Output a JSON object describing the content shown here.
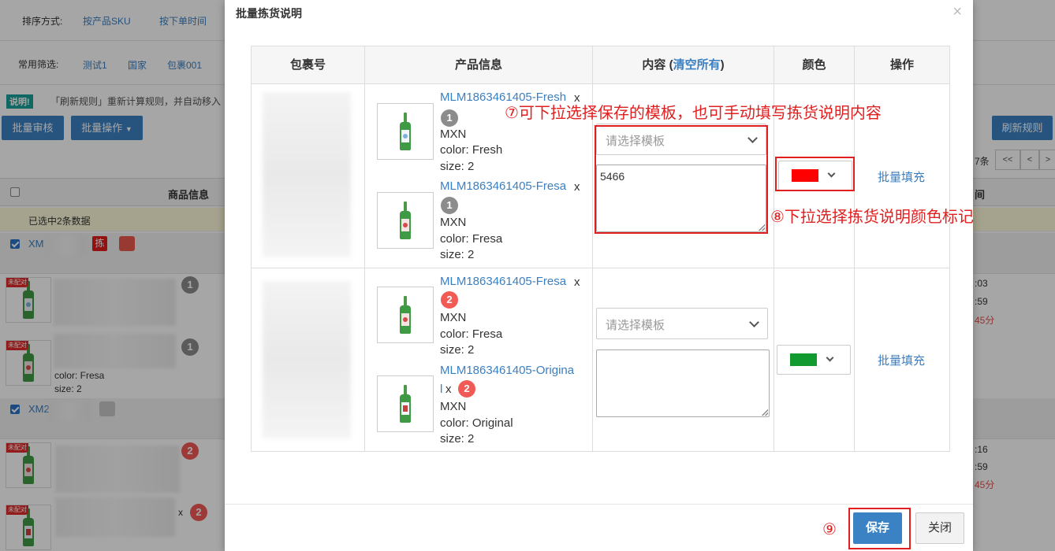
{
  "background": {
    "sort": {
      "label": "排序方式:",
      "options": [
        "按产品SKU",
        "按下单时间"
      ]
    },
    "filters": {
      "label": "常用筛选:",
      "items": [
        "测试1",
        "国家",
        "包裹001"
      ]
    },
    "note": {
      "badge": "说明!",
      "text": "「刷新规则」重新计算规则，并自动移入"
    },
    "buttons": {
      "batch_review": "批量审核",
      "batch_ops": "批量操作",
      "refresh_rules": "刷新规则"
    },
    "pager": {
      "count_suffix": "7条",
      "first": "<<",
      "prev": "<",
      "next": ">"
    },
    "table": {
      "col_product": "商品信息",
      "col_time": "间",
      "selected_text": "已选中2条数据"
    },
    "orders": [
      {
        "id": "XM",
        "tag": "拣",
        "items": [
          {
            "badge": "未配对",
            "qty": "1"
          },
          {
            "badge": "未配对",
            "qty": "1",
            "color": "color: Fresa",
            "size": "size: 2"
          }
        ],
        "times": [
          ":03",
          ":59"
        ],
        "remain": "45分"
      },
      {
        "id": "XM2",
        "items": [
          {
            "badge": "未配对",
            "qty": "2"
          },
          {
            "badge": "未配对",
            "qty": "2",
            "x": "x"
          }
        ],
        "times": [
          ":16",
          ":59"
        ],
        "remain": "45分"
      }
    ]
  },
  "modal": {
    "title": "批量拣货说明",
    "close": "×",
    "headers": {
      "package": "包裹号",
      "product": "产品信息",
      "content_prefix": "内容 (",
      "clear_all": "清空所有",
      "content_suffix": ")",
      "color": "颜色",
      "action": "操作"
    },
    "rows": [
      {
        "products": [
          {
            "sku": "MLM1863461405-Fresh",
            "x": "x",
            "qty": "1",
            "currency": "MXN",
            "color": "color:  Fresh",
            "size": "size:  2"
          },
          {
            "sku": "MLM1863461405-Fresa",
            "x": "x",
            "qty": "1",
            "currency": "MXN",
            "color": "color:  Fresa",
            "size": "size:  2"
          }
        ],
        "template_placeholder": "请选择模板",
        "content": "5466",
        "color_hex": "#ff0000",
        "fill_label": "批量填充"
      },
      {
        "products": [
          {
            "sku": "MLM1863461405-Fresa",
            "x": "x",
            "qty": "2",
            "currency": "MXN",
            "color": "color:  Fresa",
            "size": "size:  2"
          },
          {
            "sku_line1": "MLM1863461405-Origina",
            "sku_line2": "l",
            "x": "x",
            "qty": "2",
            "currency": "MXN",
            "color": "color:  Original",
            "size": "size:  2"
          }
        ],
        "template_placeholder": "请选择模板",
        "content": "",
        "color_hex": "#119a2f",
        "fill_label": "批量填充"
      }
    ],
    "annotations": {
      "step7": "⑦可下拉选择保存的模板，也可手动填写拣货说明内容",
      "step8": "⑧下拉选择拣货说明颜色标记",
      "step9": "⑨"
    },
    "footer": {
      "save": "保存",
      "close": "关闭"
    }
  }
}
